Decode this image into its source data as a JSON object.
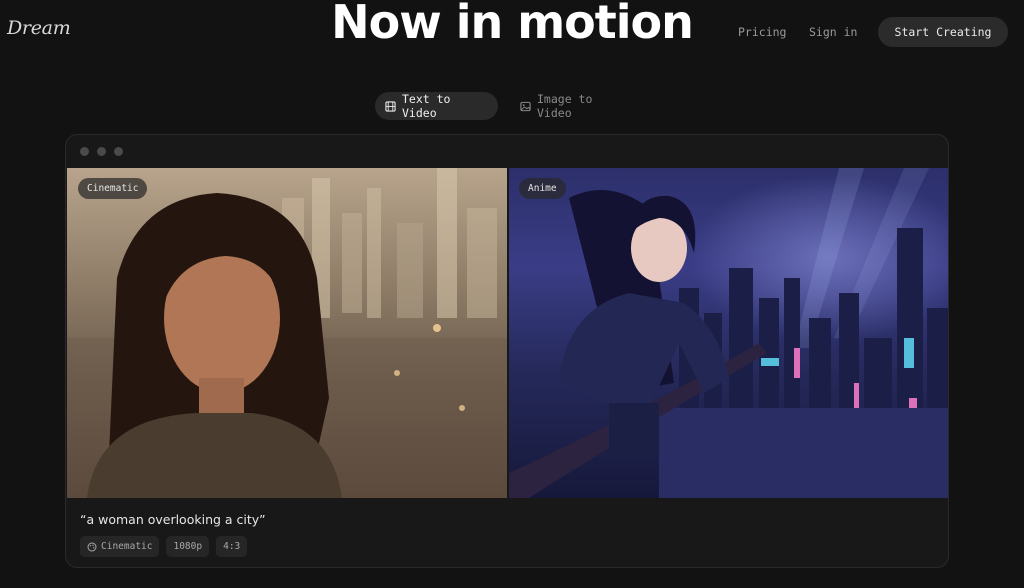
{
  "header": {
    "logo": "Dream",
    "hero_title": "Now in motion",
    "nav": {
      "pricing": "Pricing",
      "sign_in": "Sign in",
      "cta": "Start Creating"
    }
  },
  "tabs": [
    {
      "label": "Text to Video",
      "icon": "film-icon",
      "active": true
    },
    {
      "label": "Image to Video",
      "icon": "image-icon",
      "active": false
    }
  ],
  "showcase": {
    "window_dots": 3,
    "images": [
      {
        "tag": "Cinematic",
        "alt": "portrait of a woman against a blurred city skyline"
      },
      {
        "tag": "Anime",
        "alt": "anime girl on a balcony overlooking a neon city at night"
      }
    ],
    "prompt": "“a woman overlooking a city”",
    "chips": [
      {
        "label": "Cinematic",
        "icon": "palette-icon"
      },
      {
        "label": "1080p"
      },
      {
        "label": "4:3"
      }
    ]
  },
  "colors": {
    "background": "#121212",
    "card": "#181818",
    "chip": "#262626"
  }
}
